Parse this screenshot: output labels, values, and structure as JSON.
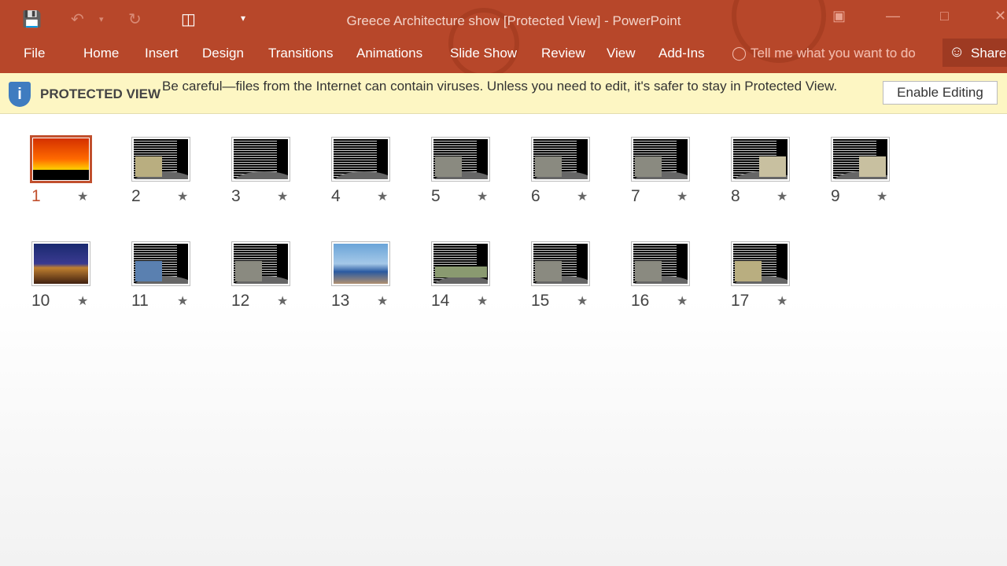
{
  "window": {
    "title": "Greece Architecture show [Protected View] - PowerPoint"
  },
  "quick_access": {
    "icons": [
      "save-icon",
      "undo-icon",
      "redo-icon",
      "present-from-start-icon",
      "customize-dropdown-icon"
    ]
  },
  "ribbon": {
    "tabs": [
      "File",
      "Home",
      "Insert",
      "Design",
      "Transitions",
      "Animations",
      "Slide Show",
      "Review",
      "View",
      "Add-Ins"
    ],
    "tell_me": "Tell me what you want to do",
    "tell_me_visible": "Tell me what you want to dc",
    "share": "Share"
  },
  "protected_view": {
    "label": "PROTECTED VIEW",
    "message": "Be careful—files from the Internet can contain viruses. Unless you need to edit, it's safer to stay in Protected View.",
    "button": "Enable Editing"
  },
  "slides": [
    {
      "n": "1"
    },
    {
      "n": "2"
    },
    {
      "n": "3"
    },
    {
      "n": "4"
    },
    {
      "n": "5"
    },
    {
      "n": "6"
    },
    {
      "n": "7"
    },
    {
      "n": "8"
    },
    {
      "n": "9"
    },
    {
      "n": "10"
    },
    {
      "n": "11"
    },
    {
      "n": "12"
    },
    {
      "n": "13"
    },
    {
      "n": "14"
    },
    {
      "n": "15"
    },
    {
      "n": "16"
    },
    {
      "n": "17"
    }
  ],
  "selected_slide": "1",
  "colors": {
    "accent": "#b7472a",
    "banner": "#fdf6c3"
  }
}
